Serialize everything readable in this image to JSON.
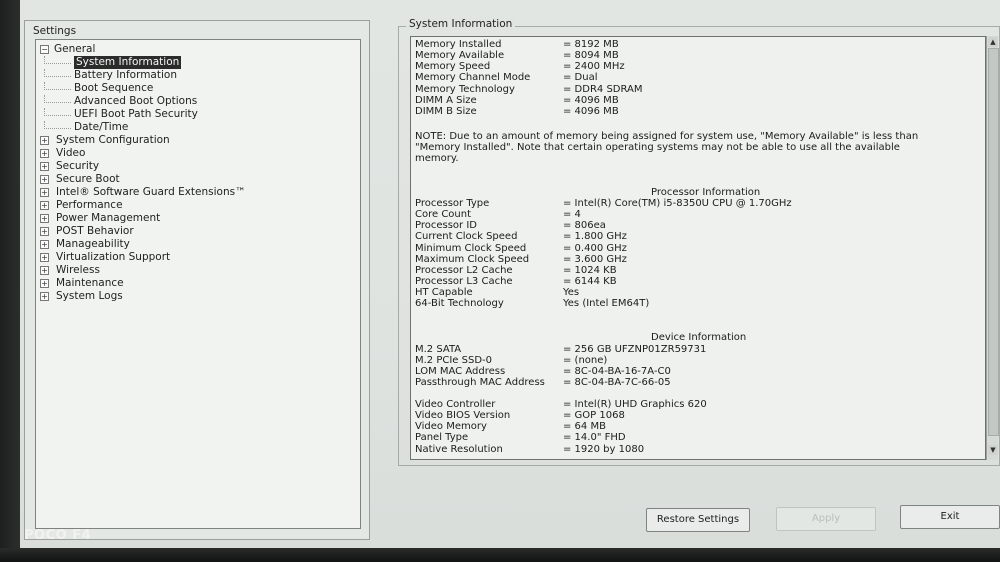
{
  "tree": {
    "title": "Settings",
    "general": "General",
    "general_children": [
      "System Information",
      "Battery Information",
      "Boot Sequence",
      "Advanced Boot Options",
      "UEFI Boot Path Security",
      "Date/Time"
    ],
    "sections": [
      "System Configuration",
      "Video",
      "Security",
      "Secure Boot",
      "Intel® Software Guard Extensions™",
      "Performance",
      "Power Management",
      "POST Behavior",
      "Manageability",
      "Virtualization Support",
      "Wireless",
      "Maintenance",
      "System Logs"
    ],
    "expand_glyph": "+",
    "collapse_glyph": "−"
  },
  "info": {
    "group_title": "System Information",
    "memory": [
      {
        "label": "Memory Installed",
        "value": "= 8192 MB"
      },
      {
        "label": "Memory Available",
        "value": "= 8094 MB"
      },
      {
        "label": "Memory Speed",
        "value": "= 2400 MHz"
      },
      {
        "label": "Memory Channel Mode",
        "value": "= Dual"
      },
      {
        "label": "Memory Technology",
        "value": "= DDR4 SDRAM"
      },
      {
        "label": "DIMM A Size",
        "value": "= 4096 MB"
      },
      {
        "label": "DIMM B Size",
        "value": "= 4096 MB"
      }
    ],
    "note": "NOTE: Due to an amount of memory being assigned for system use, \"Memory Available\" is less than \"Memory Installed\". Note that certain operating systems may not be able to use all the available memory.",
    "processor_heading": "Processor Information",
    "processor": [
      {
        "label": "Processor Type",
        "value": "= Intel(R) Core(TM) i5-8350U CPU @ 1.70GHz"
      },
      {
        "label": "Core Count",
        "value": "= 4"
      },
      {
        "label": "Processor ID",
        "value": "= 806ea"
      },
      {
        "label": "Current Clock Speed",
        "value": "= 1.800 GHz"
      },
      {
        "label": "Minimum Clock Speed",
        "value": "= 0.400 GHz"
      },
      {
        "label": "Maximum Clock Speed",
        "value": "= 3.600 GHz"
      },
      {
        "label": "Processor L2 Cache",
        "value": "= 1024 KB"
      },
      {
        "label": "Processor L3 Cache",
        "value": "= 6144 KB"
      },
      {
        "label": "HT Capable",
        "value": "Yes"
      },
      {
        "label": "64-Bit Technology",
        "value": "Yes (Intel EM64T)"
      }
    ],
    "device_heading": "Device Information",
    "device": [
      {
        "label": "M.2 SATA",
        "value": "= 256 GB UFZNP01ZR59731"
      },
      {
        "label": "M.2 PCIe SSD-0",
        "value": "= (none)"
      },
      {
        "label": "LOM MAC Address",
        "value": "= 8C-04-BA-16-7A-C0"
      },
      {
        "label": "Passthrough MAC Address",
        "value": "= 8C-04-BA-7C-66-05"
      }
    ],
    "video": [
      {
        "label": "Video Controller",
        "value": "= Intel(R) UHD Graphics 620"
      },
      {
        "label": "Video BIOS Version",
        "value": "= GOP 1068"
      },
      {
        "label": "Video Memory",
        "value": "= 64 MB"
      },
      {
        "label": "Panel Type",
        "value": "= 14.0\" FHD"
      },
      {
        "label": "Native Resolution",
        "value": "= 1920 by 1080"
      }
    ]
  },
  "buttons": {
    "restore": "Restore Settings",
    "apply": "Apply",
    "exit": "Exit"
  },
  "scroll": {
    "up": "▲",
    "down": "▼"
  },
  "watermark": "POCO F4"
}
